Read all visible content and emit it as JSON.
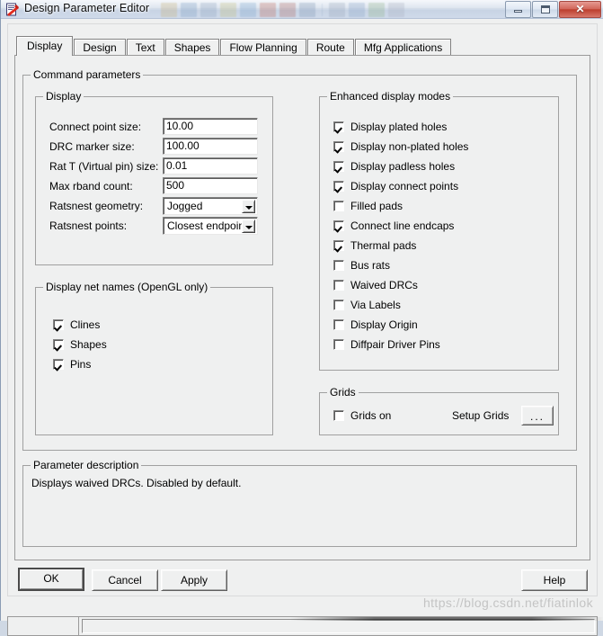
{
  "window": {
    "title": "Design Parameter Editor",
    "icon": "document-red-swoosh-icon",
    "minimize_label": "Minimize",
    "maximize_label": "Maximize",
    "close_label": "✕"
  },
  "tabs": [
    {
      "label": "Display",
      "active": true
    },
    {
      "label": "Design",
      "active": false
    },
    {
      "label": "Text",
      "active": false
    },
    {
      "label": "Shapes",
      "active": false
    },
    {
      "label": "Flow Planning",
      "active": false
    },
    {
      "label": "Route",
      "active": false
    },
    {
      "label": "Mfg Applications",
      "active": false
    }
  ],
  "command_parameters": {
    "title": "Command parameters",
    "display_group": {
      "title": "Display",
      "fields": [
        {
          "label": "Connect point size:",
          "value": "10.00",
          "type": "text"
        },
        {
          "label": "DRC marker size:",
          "value": "100.00",
          "type": "text"
        },
        {
          "label": "Rat T (Virtual pin) size:",
          "value": "0.01",
          "type": "text"
        },
        {
          "label": "Max rband count:",
          "value": "500",
          "type": "text"
        },
        {
          "label": "Ratsnest geometry:",
          "value": "Jogged",
          "type": "combo"
        },
        {
          "label": "Ratsnest points:",
          "value": "Closest endpoint",
          "type": "combo"
        }
      ]
    },
    "net_names_group": {
      "title": "Display net names (OpenGL only)",
      "items": [
        {
          "label": "Clines",
          "checked": true
        },
        {
          "label": "Shapes",
          "checked": true
        },
        {
          "label": "Pins",
          "checked": true
        }
      ]
    },
    "enhanced_group": {
      "title": "Enhanced display modes",
      "items": [
        {
          "label": "Display plated holes",
          "checked": true
        },
        {
          "label": "Display non-plated holes",
          "checked": true
        },
        {
          "label": "Display padless holes",
          "checked": true
        },
        {
          "label": "Display connect points",
          "checked": true
        },
        {
          "label": "Filled pads",
          "checked": false
        },
        {
          "label": "Connect line endcaps",
          "checked": true
        },
        {
          "label": "Thermal pads",
          "checked": true
        },
        {
          "label": "Bus rats",
          "checked": false
        },
        {
          "label": "Waived DRCs",
          "checked": false
        },
        {
          "label": "Via Labels",
          "checked": false
        },
        {
          "label": "Display Origin",
          "checked": false
        },
        {
          "label": "Diffpair Driver Pins",
          "checked": false
        }
      ]
    },
    "grids_group": {
      "title": "Grids",
      "grids_on": {
        "label": "Grids on",
        "checked": false
      },
      "setup_label": "Setup Grids",
      "setup_button_label": "..."
    }
  },
  "parameter_description": {
    "title": "Parameter description",
    "text": "Displays waived DRCs. Disabled by default."
  },
  "buttons": {
    "ok": "OK",
    "cancel": "Cancel",
    "apply": "Apply",
    "help": "Help"
  },
  "watermark": "https://blog.csdn.net/fiatinlok",
  "colors": {
    "dialog_face": "#eff0f0",
    "title_glass": "#d2dcea",
    "close_button": "#bc3e2e",
    "field_bg": "#ffffff",
    "frame_line": "#a0a0a0"
  }
}
